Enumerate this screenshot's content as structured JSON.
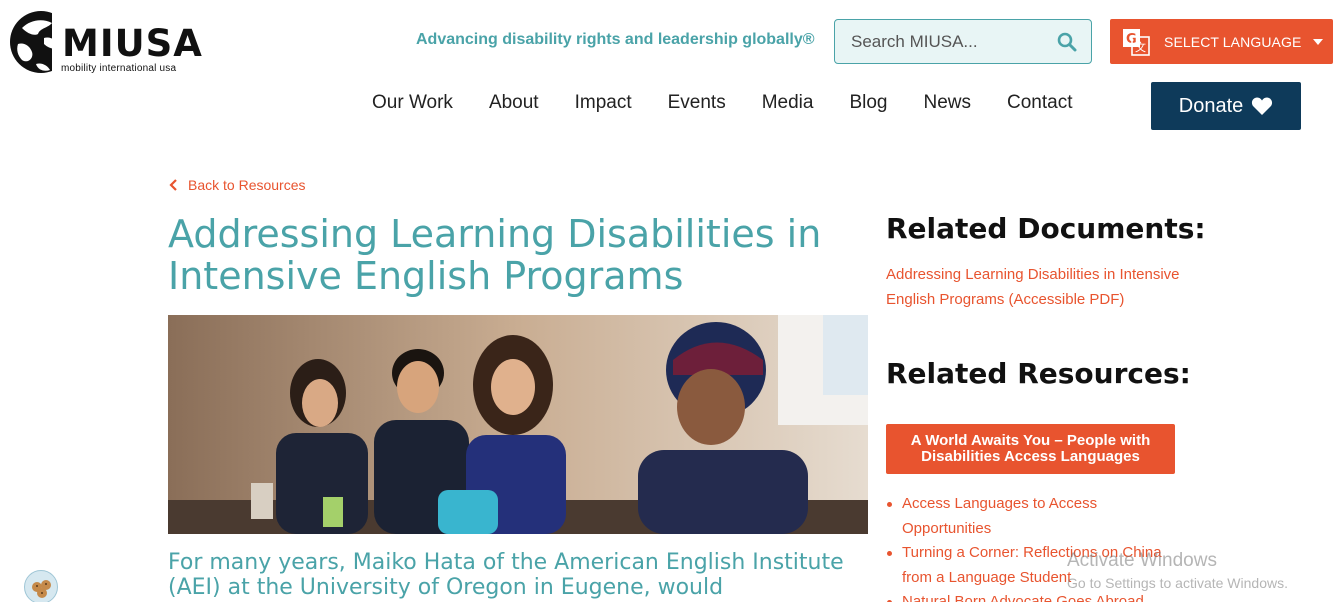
{
  "header": {
    "logo_word": "MIUSA",
    "logo_sub": "mobility international usa",
    "tagline": "Advancing disability rights and leadership globally®",
    "search": {
      "placeholder": "Search MIUSA...",
      "icon": "search-icon"
    },
    "language": {
      "label": "SELECT LANGUAGE",
      "icon": "translate-icon"
    }
  },
  "nav": {
    "items": [
      "Our Work",
      "About",
      "Impact",
      "Events",
      "Media",
      "Blog",
      "News",
      "Contact"
    ],
    "donate_label": "Donate",
    "donate_icon": "heart-icon"
  },
  "content": {
    "back_label": "Back to Resources",
    "title": "Addressing Learning Disabilities in Intensive English Programs",
    "lead": "For many years, Maiko Hata of the American English Institute (AEI) at the University of Oregon in Eugene, would"
  },
  "sidebar": {
    "docs_heading": "Related Documents:",
    "doc_link": "Addressing Learning Disabilities in Intensive English Programs (Accessible PDF)",
    "res_heading": "Related Resources:",
    "featured": "A World Awaits You – People with Disabilities Access Languages",
    "resources": [
      "Access Languages to Access Opportunities",
      "Turning a Corner: Reflections on China from a Language Student",
      "Natural Born Advocate Goes Abroad"
    ]
  },
  "watermark": {
    "line1": "Activate Windows",
    "line2": "Go to Settings to activate Windows."
  },
  "colors": {
    "teal": "#4aa3a8",
    "orange": "#e8542f",
    "navy": "#0e3a5a"
  }
}
